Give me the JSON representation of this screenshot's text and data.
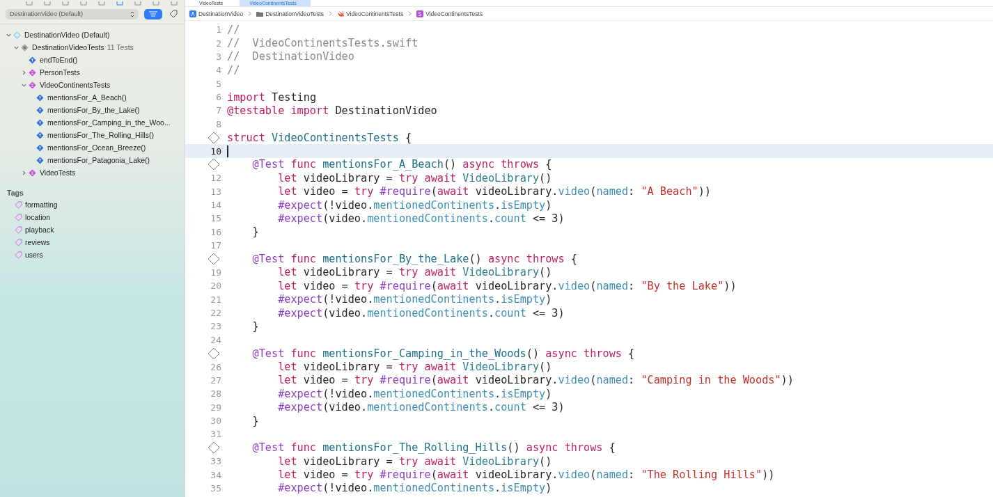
{
  "sidebar": {
    "scheme": {
      "value": "DestinationVideo (Default)"
    },
    "tree": [
      {
        "label": "DestinationVideo (Default)",
        "kind": "project",
        "expanded": true,
        "children": [
          {
            "label": "DestinationVideoTests",
            "count": "11 Tests",
            "kind": "target",
            "expanded": true,
            "children": [
              {
                "label": "endToEnd()",
                "kind": "test"
              },
              {
                "label": "PersonTests",
                "kind": "suite",
                "expanded": false
              },
              {
                "label": "VideoContinentsTests",
                "kind": "suite",
                "expanded": true,
                "children": [
                  {
                    "label": "mentionsFor_A_Beach()",
                    "kind": "test"
                  },
                  {
                    "label": "mentionsFor_By_the_Lake()",
                    "kind": "test"
                  },
                  {
                    "label": "mentionsFor_Camping_in_the_Woo...",
                    "kind": "test"
                  },
                  {
                    "label": "mentionsFor_The_Rolling_Hills()",
                    "kind": "test"
                  },
                  {
                    "label": "mentionsFor_Ocean_Breeze()",
                    "kind": "test"
                  },
                  {
                    "label": "mentionsFor_Patagonia_Lake()",
                    "kind": "test"
                  }
                ]
              },
              {
                "label": "VideoTests",
                "kind": "suite",
                "expanded": false
              }
            ]
          }
        ]
      }
    ],
    "tags_title": "Tags",
    "tags": [
      "formatting",
      "location",
      "playback",
      "reviews",
      "users"
    ]
  },
  "tabs": [
    {
      "label": "VideoTests",
      "selected": false
    },
    {
      "label": "VideoContinentsTests",
      "selected": true
    }
  ],
  "breadcrumb": [
    {
      "label": "DestinationVideo",
      "kind": "app"
    },
    {
      "label": "DestinationVideoTests",
      "kind": "folder"
    },
    {
      "label": "VideoContinentsTests",
      "kind": "swift"
    },
    {
      "label": "VideoContinentsTests",
      "kind": "struct"
    }
  ],
  "lines": [
    {
      "number": "1",
      "segs": [
        {
          "t": "//",
          "kind": "comment"
        }
      ]
    },
    {
      "number": "2",
      "segs": [
        {
          "t": "//  VideoContinentsTests.swift",
          "kind": "comment"
        }
      ]
    },
    {
      "number": "3",
      "segs": [
        {
          "t": "//  DestinationVideo",
          "kind": "comment"
        }
      ]
    },
    {
      "number": "4",
      "segs": [
        {
          "t": "//",
          "kind": "comment"
        }
      ]
    },
    {
      "number": "5"
    },
    {
      "number": "6",
      "segs": [
        {
          "t": "import",
          "kind": "keyword"
        },
        {
          "t": " Testing",
          "kind": "plain"
        }
      ]
    },
    {
      "number": "7",
      "segs": [
        {
          "t": "@testable",
          "kind": "keyword"
        },
        {
          "t": " import",
          "kind": "keyword"
        },
        {
          "t": " DestinationVideo",
          "kind": "plain"
        }
      ]
    },
    {
      "number": "8"
    },
    {
      "test_marker": true,
      "segs": [
        {
          "t": "struct",
          "kind": "keyword"
        },
        {
          "t": " VideoContinentsTests",
          "kind": "decl"
        },
        {
          "t": " {",
          "kind": "plain"
        }
      ]
    },
    {
      "number": "10",
      "current": true
    },
    {
      "test_marker": true,
      "segs": [
        {
          "t": "    @Test",
          "kind": "macro"
        },
        {
          "t": " func",
          "kind": "keyword"
        },
        {
          "t": " mentionsFor_A_Beach",
          "kind": "decl"
        },
        {
          "t": "()",
          "kind": "plain"
        },
        {
          "t": " async",
          "kind": "keyword"
        },
        {
          "t": " throws",
          "kind": "keyword"
        },
        {
          "t": " {",
          "kind": "plain"
        }
      ]
    },
    {
      "number": "12",
      "segs": [
        {
          "t": "        let",
          "kind": "keyword"
        },
        {
          "t": " videoLibrary = ",
          "kind": "plain"
        },
        {
          "t": "try",
          "kind": "keyword"
        },
        {
          "t": " await",
          "kind": "keyword"
        },
        {
          "t": " VideoLibrary",
          "kind": "type"
        },
        {
          "t": "()",
          "kind": "plain"
        }
      ]
    },
    {
      "number": "13",
      "segs": [
        {
          "t": "        let",
          "kind": "keyword"
        },
        {
          "t": " video = ",
          "kind": "plain"
        },
        {
          "t": "try",
          "kind": "keyword"
        },
        {
          "t": " #require",
          "kind": "macro"
        },
        {
          "t": "(",
          "kind": "plain"
        },
        {
          "t": "await",
          "kind": "keyword"
        },
        {
          "t": " videoLibrary.",
          "kind": "plain"
        },
        {
          "t": "video",
          "kind": "member"
        },
        {
          "t": "(",
          "kind": "plain"
        },
        {
          "t": "named",
          "kind": "member"
        },
        {
          "t": ": ",
          "kind": "plain"
        },
        {
          "t": "\"A Beach\"",
          "kind": "string"
        },
        {
          "t": "))",
          "kind": "plain"
        }
      ]
    },
    {
      "number": "14",
      "segs": [
        {
          "t": "        #expect",
          "kind": "macro"
        },
        {
          "t": "(!video.",
          "kind": "plain"
        },
        {
          "t": "mentionedContinents",
          "kind": "member"
        },
        {
          "t": ".",
          "kind": "plain"
        },
        {
          "t": "isEmpty",
          "kind": "member"
        },
        {
          "t": ")",
          "kind": "plain"
        }
      ]
    },
    {
      "number": "15",
      "segs": [
        {
          "t": "        #expect",
          "kind": "macro"
        },
        {
          "t": "(video.",
          "kind": "plain"
        },
        {
          "t": "mentionedContinents",
          "kind": "member"
        },
        {
          "t": ".",
          "kind": "plain"
        },
        {
          "t": "count",
          "kind": "member"
        },
        {
          "t": " <= 3)",
          "kind": "plain"
        }
      ]
    },
    {
      "number": "16",
      "segs": [
        {
          "t": "    }",
          "kind": "plain"
        }
      ]
    },
    {
      "number": "17"
    },
    {
      "test_marker": true,
      "segs": [
        {
          "t": "    @Test",
          "kind": "macro"
        },
        {
          "t": " func",
          "kind": "keyword"
        },
        {
          "t": " mentionsFor_By_the_Lake",
          "kind": "decl"
        },
        {
          "t": "()",
          "kind": "plain"
        },
        {
          "t": " async",
          "kind": "keyword"
        },
        {
          "t": " throws",
          "kind": "keyword"
        },
        {
          "t": " {",
          "kind": "plain"
        }
      ]
    },
    {
      "number": "19",
      "segs": [
        {
          "t": "        let",
          "kind": "keyword"
        },
        {
          "t": " videoLibrary = ",
          "kind": "plain"
        },
        {
          "t": "try",
          "kind": "keyword"
        },
        {
          "t": " await",
          "kind": "keyword"
        },
        {
          "t": " VideoLibrary",
          "kind": "type"
        },
        {
          "t": "()",
          "kind": "plain"
        }
      ]
    },
    {
      "number": "20",
      "segs": [
        {
          "t": "        let",
          "kind": "keyword"
        },
        {
          "t": " video = ",
          "kind": "plain"
        },
        {
          "t": "try",
          "kind": "keyword"
        },
        {
          "t": " #require",
          "kind": "macro"
        },
        {
          "t": "(",
          "kind": "plain"
        },
        {
          "t": "await",
          "kind": "keyword"
        },
        {
          "t": " videoLibrary.",
          "kind": "plain"
        },
        {
          "t": "video",
          "kind": "member"
        },
        {
          "t": "(",
          "kind": "plain"
        },
        {
          "t": "named",
          "kind": "member"
        },
        {
          "t": ": ",
          "kind": "plain"
        },
        {
          "t": "\"By the Lake\"",
          "kind": "string"
        },
        {
          "t": "))",
          "kind": "plain"
        }
      ]
    },
    {
      "number": "21",
      "segs": [
        {
          "t": "        #expect",
          "kind": "macro"
        },
        {
          "t": "(!video.",
          "kind": "plain"
        },
        {
          "t": "mentionedContinents",
          "kind": "member"
        },
        {
          "t": ".",
          "kind": "plain"
        },
        {
          "t": "isEmpty",
          "kind": "member"
        },
        {
          "t": ")",
          "kind": "plain"
        }
      ]
    },
    {
      "number": "22",
      "segs": [
        {
          "t": "        #expect",
          "kind": "macro"
        },
        {
          "t": "(video.",
          "kind": "plain"
        },
        {
          "t": "mentionedContinents",
          "kind": "member"
        },
        {
          "t": ".",
          "kind": "plain"
        },
        {
          "t": "count",
          "kind": "member"
        },
        {
          "t": " <= 3)",
          "kind": "plain"
        }
      ]
    },
    {
      "number": "23",
      "segs": [
        {
          "t": "    }",
          "kind": "plain"
        }
      ]
    },
    {
      "number": "24"
    },
    {
      "test_marker": true,
      "segs": [
        {
          "t": "    @Test",
          "kind": "macro"
        },
        {
          "t": " func",
          "kind": "keyword"
        },
        {
          "t": " mentionsFor_Camping_in_the_Woods",
          "kind": "decl"
        },
        {
          "t": "()",
          "kind": "plain"
        },
        {
          "t": " async",
          "kind": "keyword"
        },
        {
          "t": " throws",
          "kind": "keyword"
        },
        {
          "t": " {",
          "kind": "plain"
        }
      ]
    },
    {
      "number": "26",
      "segs": [
        {
          "t": "        let",
          "kind": "keyword"
        },
        {
          "t": " videoLibrary = ",
          "kind": "plain"
        },
        {
          "t": "try",
          "kind": "keyword"
        },
        {
          "t": " await",
          "kind": "keyword"
        },
        {
          "t": " VideoLibrary",
          "kind": "type"
        },
        {
          "t": "()",
          "kind": "plain"
        }
      ]
    },
    {
      "number": "27",
      "segs": [
        {
          "t": "        let",
          "kind": "keyword"
        },
        {
          "t": " video = ",
          "kind": "plain"
        },
        {
          "t": "try",
          "kind": "keyword"
        },
        {
          "t": " #require",
          "kind": "macro"
        },
        {
          "t": "(",
          "kind": "plain"
        },
        {
          "t": "await",
          "kind": "keyword"
        },
        {
          "t": " videoLibrary.",
          "kind": "plain"
        },
        {
          "t": "video",
          "kind": "member"
        },
        {
          "t": "(",
          "kind": "plain"
        },
        {
          "t": "named",
          "kind": "member"
        },
        {
          "t": ": ",
          "kind": "plain"
        },
        {
          "t": "\"Camping in the Woods\"",
          "kind": "string"
        },
        {
          "t": "))",
          "kind": "plain"
        }
      ]
    },
    {
      "number": "28",
      "segs": [
        {
          "t": "        #expect",
          "kind": "macro"
        },
        {
          "t": "(!video.",
          "kind": "plain"
        },
        {
          "t": "mentionedContinents",
          "kind": "member"
        },
        {
          "t": ".",
          "kind": "plain"
        },
        {
          "t": "isEmpty",
          "kind": "member"
        },
        {
          "t": ")",
          "kind": "plain"
        }
      ]
    },
    {
      "number": "29",
      "segs": [
        {
          "t": "        #expect",
          "kind": "macro"
        },
        {
          "t": "(video.",
          "kind": "plain"
        },
        {
          "t": "mentionedContinents",
          "kind": "member"
        },
        {
          "t": ".",
          "kind": "plain"
        },
        {
          "t": "count",
          "kind": "member"
        },
        {
          "t": " <= 3)",
          "kind": "plain"
        }
      ]
    },
    {
      "number": "30",
      "segs": [
        {
          "t": "    }",
          "kind": "plain"
        }
      ]
    },
    {
      "number": "31"
    },
    {
      "test_marker": true,
      "segs": [
        {
          "t": "    @Test",
          "kind": "macro"
        },
        {
          "t": " func",
          "kind": "keyword"
        },
        {
          "t": " mentionsFor_The_Rolling_Hills",
          "kind": "decl"
        },
        {
          "t": "()",
          "kind": "plain"
        },
        {
          "t": " async",
          "kind": "keyword"
        },
        {
          "t": " throws",
          "kind": "keyword"
        },
        {
          "t": " {",
          "kind": "plain"
        }
      ]
    },
    {
      "number": "33",
      "segs": [
        {
          "t": "        let",
          "kind": "keyword"
        },
        {
          "t": " videoLibrary = ",
          "kind": "plain"
        },
        {
          "t": "try",
          "kind": "keyword"
        },
        {
          "t": " await",
          "kind": "keyword"
        },
        {
          "t": " VideoLibrary",
          "kind": "type"
        },
        {
          "t": "()",
          "kind": "plain"
        }
      ]
    },
    {
      "number": "34",
      "segs": [
        {
          "t": "        let",
          "kind": "keyword"
        },
        {
          "t": " video = ",
          "kind": "plain"
        },
        {
          "t": "try",
          "kind": "keyword"
        },
        {
          "t": " #require",
          "kind": "macro"
        },
        {
          "t": "(",
          "kind": "plain"
        },
        {
          "t": "await",
          "kind": "keyword"
        },
        {
          "t": " videoLibrary.",
          "kind": "plain"
        },
        {
          "t": "video",
          "kind": "member"
        },
        {
          "t": "(",
          "kind": "plain"
        },
        {
          "t": "named",
          "kind": "member"
        },
        {
          "t": ": ",
          "kind": "plain"
        },
        {
          "t": "\"The Rolling Hills\"",
          "kind": "string"
        },
        {
          "t": "))",
          "kind": "plain"
        }
      ]
    },
    {
      "number": "35",
      "segs": [
        {
          "t": "        #expect",
          "kind": "macro"
        },
        {
          "t": "(!video.",
          "kind": "plain"
        },
        {
          "t": "mentionedContinents",
          "kind": "member"
        },
        {
          "t": ".",
          "kind": "plain"
        },
        {
          "t": "isEmpty",
          "kind": "member"
        },
        {
          "t": ")",
          "kind": "plain"
        }
      ]
    }
  ]
}
